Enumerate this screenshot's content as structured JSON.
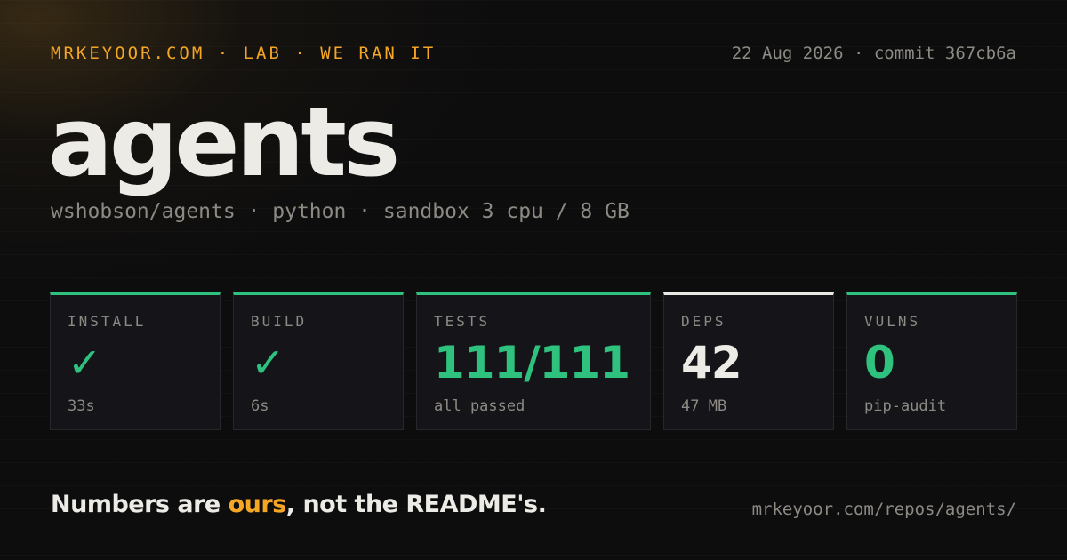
{
  "header": {
    "kicker": "MRKEYOOR.COM · LAB · WE RAN IT",
    "meta": "22 Aug 2026 · commit 367cb6a"
  },
  "title": "agents",
  "subtitle": "wshobson/agents · python · sandbox 3 cpu / 8 GB",
  "stats": [
    {
      "label": "INSTALL",
      "value": "✓",
      "note": "33s",
      "status": "pass"
    },
    {
      "label": "BUILD",
      "value": "✓",
      "note": "6s",
      "status": "pass"
    },
    {
      "label": "TESTS",
      "value": "111/111",
      "note": "all passed",
      "status": "pass"
    },
    {
      "label": "DEPS",
      "value": "42",
      "note": "47 MB",
      "status": "neutral"
    },
    {
      "label": "VULNS",
      "value": "0",
      "note": "pip-audit",
      "status": "pass"
    }
  ],
  "footer": {
    "tagline_before": "Numbers are ",
    "tagline_accent": "ours",
    "tagline_after": ", not the README's.",
    "url": "mrkeyoor.com/repos/agents/"
  },
  "colors": {
    "accent": "#f5a623",
    "pass": "#2ec27e",
    "neutral": "#e9e8e3",
    "background": "#0d0d0e",
    "muted": "#8d8a84"
  }
}
